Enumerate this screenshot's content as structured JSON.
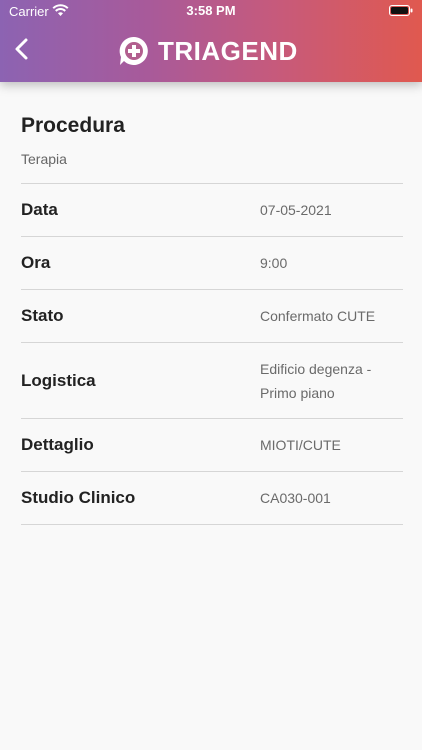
{
  "status_bar": {
    "carrier": "Carrier",
    "time": "3:58 PM",
    "icons": [
      "wifi-icon",
      "battery-icon"
    ]
  },
  "header": {
    "back_icon": "chevron-left-icon",
    "brand": "TRIAGEND",
    "colors": [
      "#8c63b2",
      "#e0594f"
    ]
  },
  "procedure": {
    "title": "Procedura",
    "subtitle": "Terapia"
  },
  "details": [
    {
      "label": "Data",
      "value": "07-05-2021"
    },
    {
      "label": "Ora",
      "value": "9:00"
    },
    {
      "label": "Stato",
      "value": "Confermato CUTE"
    },
    {
      "label": "Logistica",
      "value": "Edificio degenza - Primo piano"
    },
    {
      "label": "Dettaglio",
      "value": "MIOTI/CUTE"
    },
    {
      "label": "Studio Clinico",
      "value": "CA030-001"
    }
  ]
}
